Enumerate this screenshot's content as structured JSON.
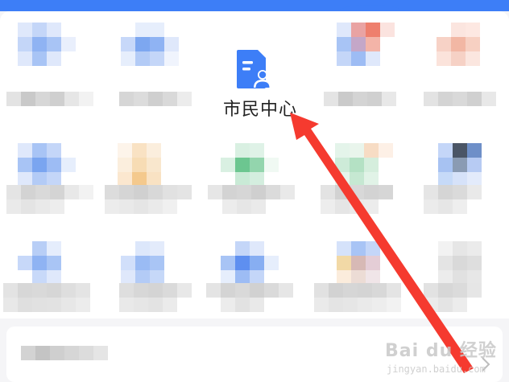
{
  "app_grid": {
    "highlighted_item": {
      "label": "市民中心",
      "icon": "citizen-center-doc-icon",
      "icon_color": "#3d7ef7"
    },
    "blurred_items_count": 14
  },
  "annotation": {
    "arrow_color": "#f53a2f"
  },
  "watermark": {
    "brand": "Bai du 经验",
    "url": "jingyan.baidu.com"
  },
  "colors": {
    "header_blue": "#3d7ef7",
    "background": "#f5f5f7"
  }
}
